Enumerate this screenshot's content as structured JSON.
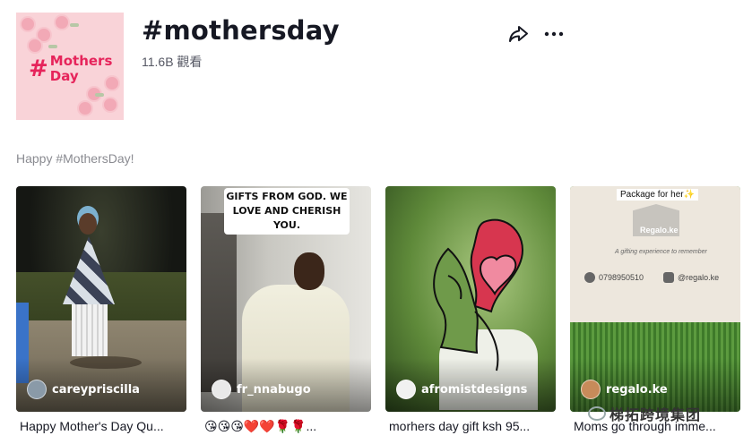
{
  "hashtag": {
    "cover_text_hash": "#",
    "cover_text_words": "Mothers Day",
    "title": "#mothersday",
    "views": "11.6B 觀看",
    "description": "Happy #MothersDay!"
  },
  "actions": {
    "share_icon": "share-arrow-icon",
    "more_icon": "more-dots-icon"
  },
  "videos": [
    {
      "username": "careypriscilla",
      "caption": "Happy Mother's Day Qu..."
    },
    {
      "username": "fr_nnabugo",
      "overlay_text": "GIFTS FROM GOD. WE LOVE AND CHERISH YOU.",
      "caption": "😘😘😘❤️❤️🌹🌹..."
    },
    {
      "username": "afromistdesigns",
      "caption": "morhers day gift ksh 95..."
    },
    {
      "username": "regalo.ke",
      "overlay_text": "Package for her✨",
      "brand": "Regalo.ke",
      "tagline": "A gifting experience to remember",
      "phone": "0798950510",
      "instagram": "@regalo.ke",
      "caption": "Moms go through imme..."
    }
  ],
  "watermark": "梯拓跨境集团",
  "colors": {
    "cover_bg": "#f9d3d8",
    "cover_text": "#e6245b",
    "title": "#161823",
    "muted": "#8a8b91"
  }
}
